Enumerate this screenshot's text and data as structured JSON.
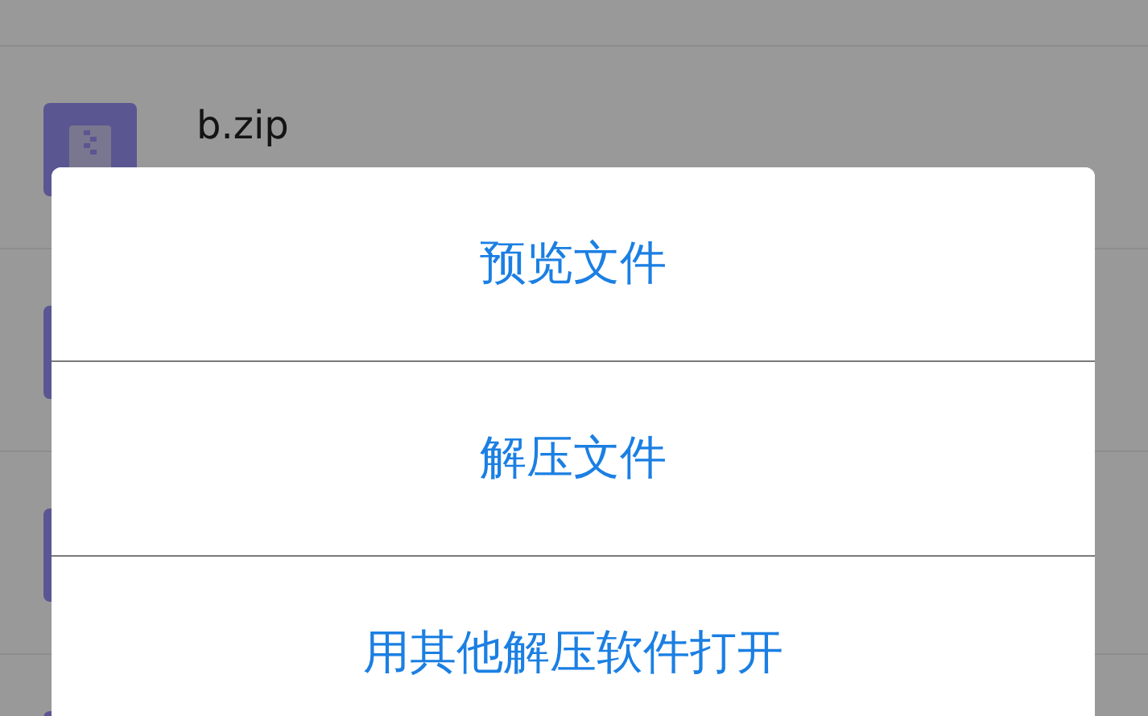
{
  "files": [
    {
      "name": "b.zip"
    }
  ],
  "dialog": {
    "options": [
      {
        "label": "预览文件"
      },
      {
        "label": "解压文件"
      },
      {
        "label": "用其他解压软件打开"
      }
    ]
  }
}
